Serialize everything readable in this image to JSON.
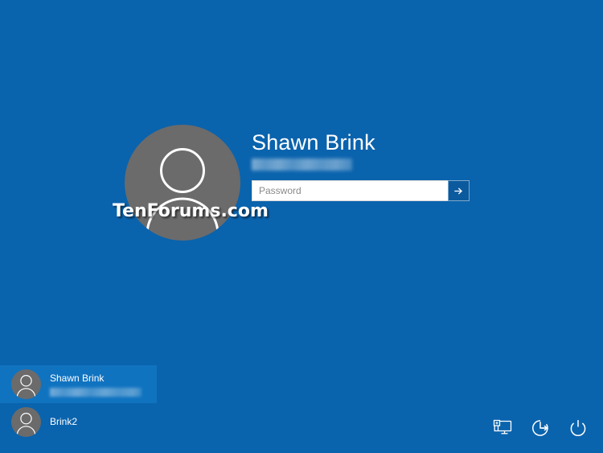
{
  "screen": {
    "name": "windows-sign-in-screen",
    "background_color": "#0a63ad"
  },
  "signin": {
    "account_name": "Shawn Brink",
    "account_email_redacted": true,
    "avatar_icon": "user-avatar-icon",
    "avatar_color": "#6b6b6b",
    "password": {
      "value": "",
      "placeholder": "Password",
      "submit_icon": "arrow-right-icon",
      "submit_button_color": "#0c5a9e"
    }
  },
  "watermark": {
    "text": "TenForums.com"
  },
  "user_list": {
    "items": [
      {
        "name": "Shawn Brink",
        "email_redacted": true,
        "selected": true,
        "avatar_icon": "user-avatar-icon"
      },
      {
        "name": "Brink2",
        "email_redacted": false,
        "selected": false,
        "avatar_icon": "user-avatar-icon"
      }
    ],
    "selected_color": "#1073c0"
  },
  "system_icons": [
    {
      "icon": "network-icon",
      "label": "Network"
    },
    {
      "icon": "ease-of-access-icon",
      "label": "Ease of Access"
    },
    {
      "icon": "power-icon",
      "label": "Power"
    }
  ]
}
